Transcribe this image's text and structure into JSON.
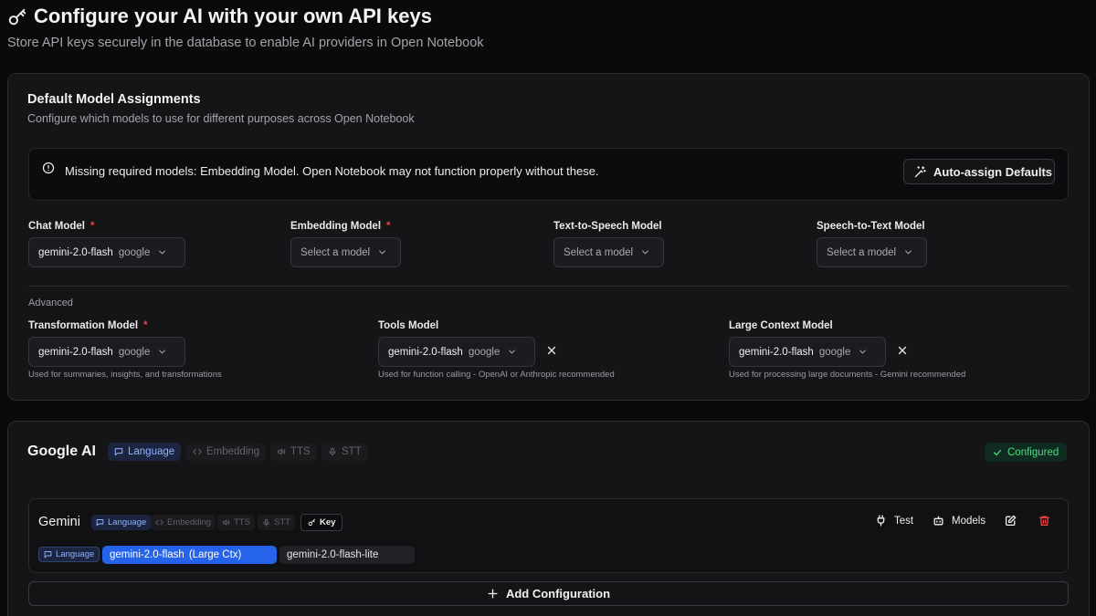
{
  "header": {
    "title": "Configure your AI with your own API keys",
    "subtitle": "Store API keys securely in the database to enable AI providers in Open Notebook"
  },
  "defaults": {
    "title": "Default Model Assignments",
    "subtitle": "Configure which models to use for different purposes across Open Notebook",
    "alert": "Missing required models: Embedding Model. Open Notebook may not function properly without these.",
    "auto_assign_label": "Auto-assign Defaults",
    "required_mark": "*",
    "fields": {
      "chat": {
        "label": "Chat Model",
        "value": "gemini-2.0-flash",
        "provider": "google"
      },
      "embedding": {
        "label": "Embedding Model",
        "placeholder": "Select a model"
      },
      "tts": {
        "label": "Text-to-Speech Model",
        "placeholder": "Select a model"
      },
      "stt": {
        "label": "Speech-to-Text Model",
        "placeholder": "Select a model"
      }
    },
    "advanced_label": "Advanced",
    "advanced": {
      "transformation": {
        "label": "Transformation Model",
        "value": "gemini-2.0-flash",
        "provider": "google",
        "hint": "Used for summaries, insights, and transformations"
      },
      "tools": {
        "label": "Tools Model",
        "value": "gemini-2.0-flash",
        "provider": "google",
        "hint": "Used for function calling - OpenAI or Anthropic recommended"
      },
      "large_context": {
        "label": "Large Context Model",
        "value": "gemini-2.0-flash",
        "provider": "google",
        "hint": "Used for processing large documents - Gemini recommended"
      }
    }
  },
  "provider": {
    "name": "Google AI",
    "capabilities": [
      "Language",
      "Embedding",
      "TTS",
      "STT"
    ],
    "status": "Configured",
    "config": {
      "name": "Gemini",
      "capabilities": [
        "Language",
        "Embedding",
        "TTS",
        "STT"
      ],
      "key_label": "Key",
      "actions": {
        "test": "Test",
        "models": "Models"
      },
      "model_type_chip": "Language",
      "models": [
        {
          "name": "gemini-2.0-flash",
          "suffix": "(Large Ctx)",
          "selected": true
        },
        {
          "name": "gemini-2.0-flash-lite",
          "selected": false
        }
      ]
    },
    "add_config_label": "Add Configuration"
  },
  "colors": {
    "accent_blue": "#2563eb",
    "required_red": "#ef4444",
    "configured_green": "#4ade80",
    "delete_red": "#ef4444"
  }
}
